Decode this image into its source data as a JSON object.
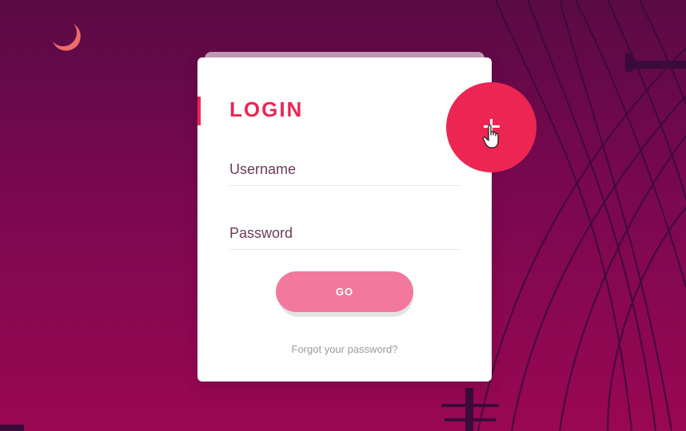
{
  "login": {
    "title": "LOGIN",
    "username_placeholder": "Username",
    "password_placeholder": "Password",
    "go_label": "GO",
    "forgot_label": "Forgot your password?"
  },
  "fab": {
    "icon": "plus-icon"
  },
  "colors": {
    "accent": "#ed2553",
    "button": "#f2789e",
    "background_top": "#5a0a44",
    "background_bottom": "#9a0752",
    "moon": "#f06c6c"
  }
}
